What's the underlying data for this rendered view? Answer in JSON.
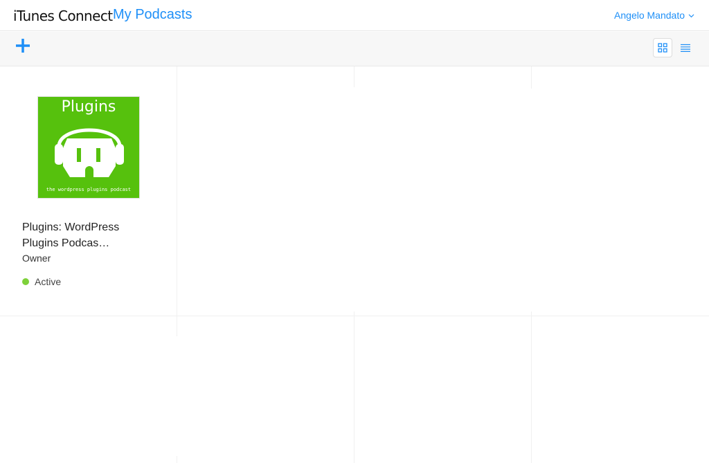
{
  "header": {
    "app_title": "iTunes Connect",
    "section_title": "My Podcasts",
    "user_name": "Angelo Mandato",
    "accent_color": "#1e8ff7"
  },
  "toolbar": {
    "add_icon": "plus-icon",
    "view_grid_icon": "grid-view-icon",
    "view_list_icon": "list-view-icon",
    "active_view": "grid"
  },
  "podcasts": [
    {
      "artwork": {
        "title": "Plugins",
        "subtitle": "the wordpress plugins podcast",
        "background_color": "#56c10d"
      },
      "title": "Plugins: WordPress Plugins Podcas…",
      "role": "Owner",
      "status": "Active",
      "status_color": "#7ed13a"
    }
  ]
}
